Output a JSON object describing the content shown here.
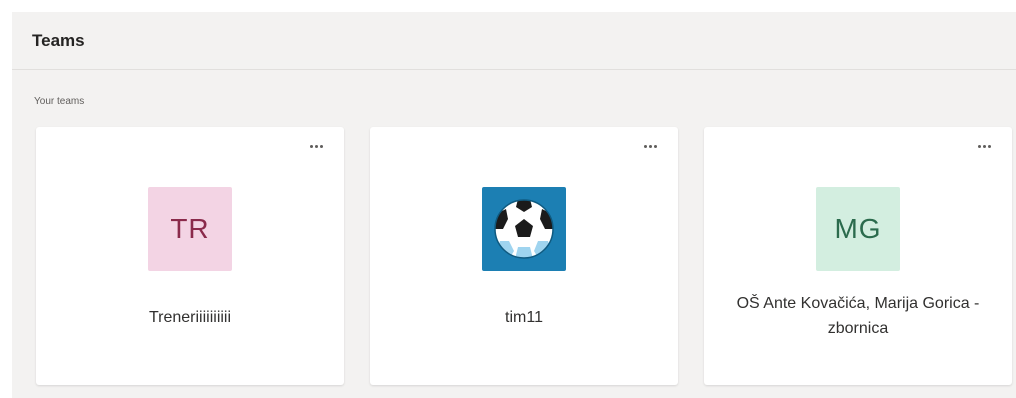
{
  "header": {
    "title": "Teams"
  },
  "section": {
    "label": "Your teams"
  },
  "teams": [
    {
      "initials": "TR",
      "name": "Treneriiiiiiiiii",
      "avatar_bg": "#f3d4e4",
      "avatar_fg": "#8a2a4b"
    },
    {
      "initials": "",
      "name": "tim11",
      "avatar_icon": "soccer-ball-icon",
      "avatar_bg": "#1c7fb3"
    },
    {
      "initials": "MG",
      "name": "OŠ Ante Kovačića, Marija Gorica - zbornica",
      "avatar_bg": "#d3eee0",
      "avatar_fg": "#2b6b4d"
    }
  ],
  "colors": {
    "app_bg": "#f3f2f1",
    "card_bg": "#ffffff"
  }
}
